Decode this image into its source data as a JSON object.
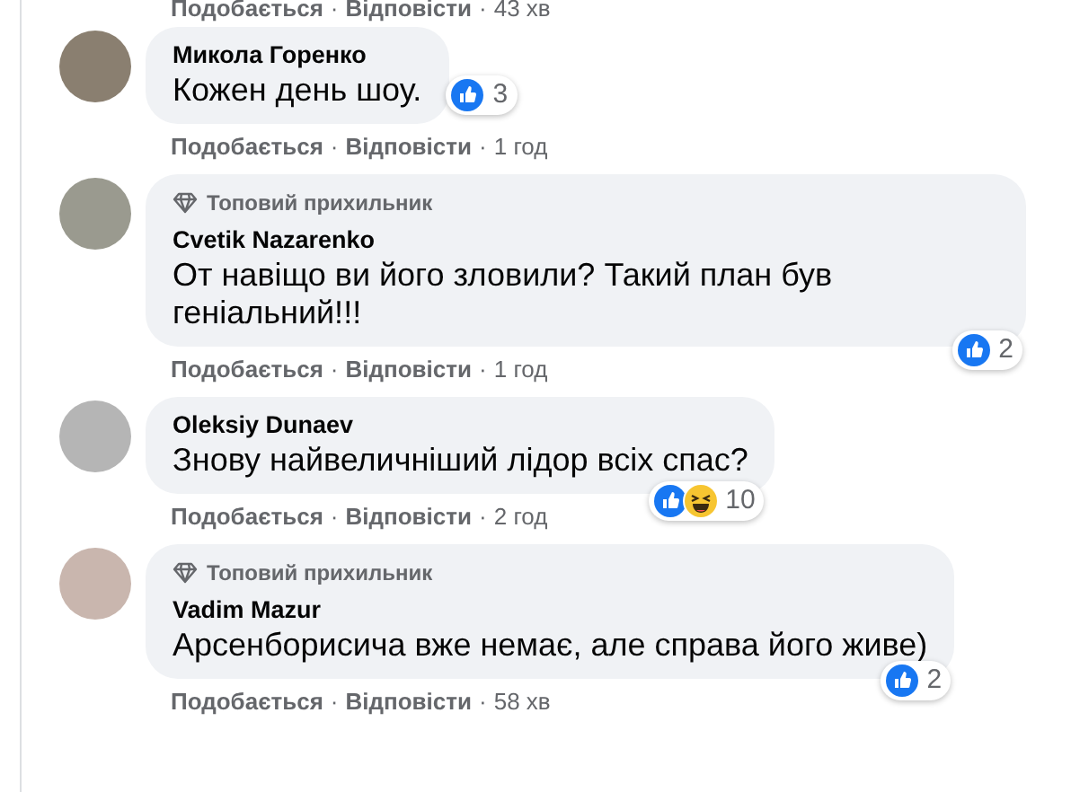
{
  "previous_actions": {
    "like": "Подобається",
    "dot_1": "·",
    "reply": "Відповісти",
    "dot_2": "·",
    "time": "43 хв"
  },
  "comments": [
    {
      "name": "Микола Горенко",
      "text": "Кожен день шоу.",
      "reactions": {
        "icons": [
          {
            "kind": "like"
          }
        ],
        "count": "3"
      },
      "actions": {
        "like": "Подобається",
        "dot_1": "·",
        "reply": "Відповісти",
        "dot_2": "·",
        "time": "1 год"
      }
    },
    {
      "badge": "Топовий прихильник",
      "name": "Cvetik Nazarenko",
      "text": "От навіщо ви його зловили? Такий план був геніальний!!!",
      "reactions": {
        "icons": [
          {
            "kind": "like"
          }
        ],
        "count": "2"
      },
      "actions": {
        "like": "Подобається",
        "dot_1": "·",
        "reply": "Відповісти",
        "dot_2": "·",
        "time": "1 год"
      }
    },
    {
      "name": "Oleksiy Dunaev",
      "text": "Знову найвеличніший лідор всіх спас?",
      "reactions": {
        "icons": [
          {
            "kind": "like"
          },
          {
            "kind": "haha"
          }
        ],
        "count": "10"
      },
      "actions": {
        "like": "Подобається",
        "dot_1": "·",
        "reply": "Відповісти",
        "dot_2": "·",
        "time": "2 год"
      }
    },
    {
      "badge": "Топовий прихильник",
      "name": "Vadim Mazur",
      "text": "Арсенборисича вже немає, але справа його живе)",
      "reactions": {
        "icons": [
          {
            "kind": "like"
          }
        ],
        "count": "2"
      },
      "actions": {
        "like": "Подобається",
        "dot_1": "·",
        "reply": "Відповісти",
        "dot_2": "·",
        "time": "58 хв"
      }
    }
  ]
}
